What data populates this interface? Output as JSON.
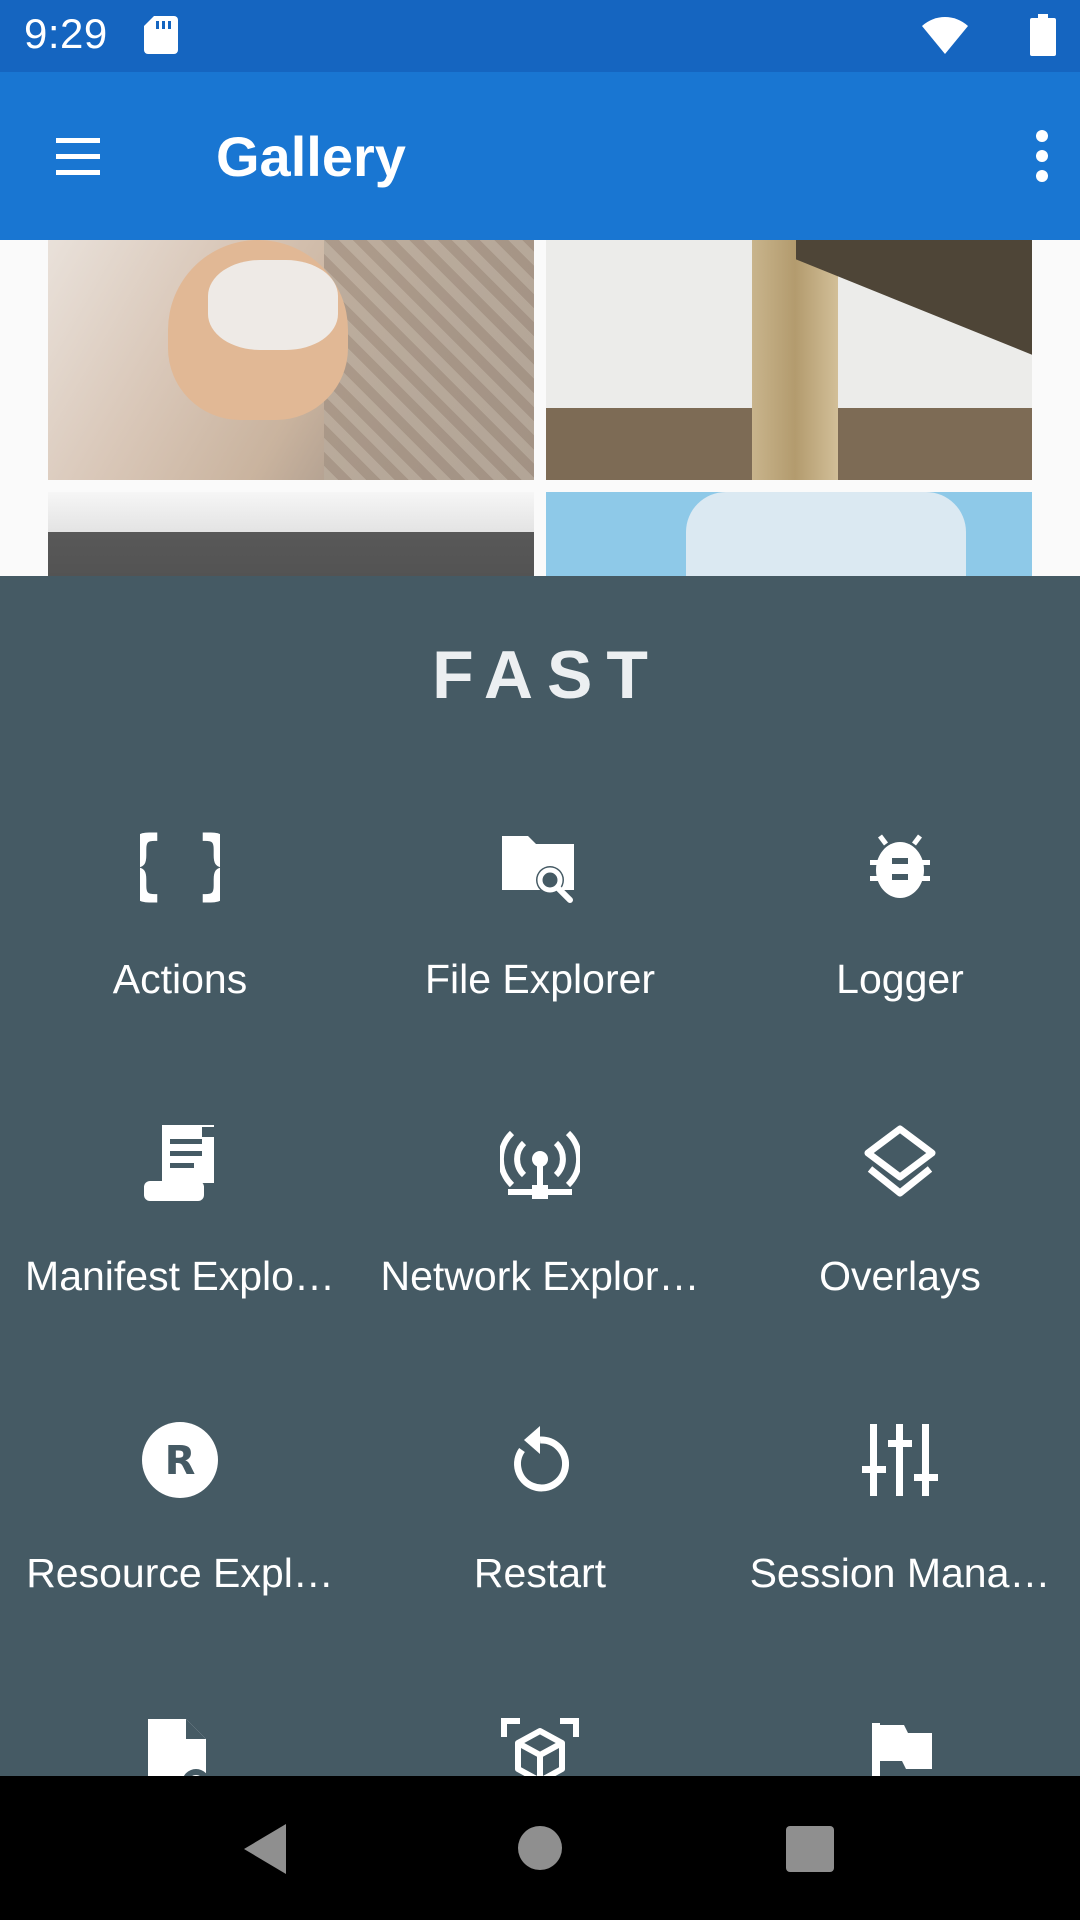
{
  "status_bar": {
    "time": "9:29"
  },
  "app_bar": {
    "title": "Gallery"
  },
  "fast_panel": {
    "title": "FAST",
    "items": [
      {
        "label": "Actions",
        "icon": "braces-icon"
      },
      {
        "label": "File Explorer",
        "icon": "folder-search-icon"
      },
      {
        "label": "Logger",
        "icon": "bug-icon"
      },
      {
        "label": "Manifest Explo…",
        "icon": "scroll-icon"
      },
      {
        "label": "Network Explor…",
        "icon": "network-antenna-icon"
      },
      {
        "label": "Overlays",
        "icon": "layers-icon"
      },
      {
        "label": "Resource Expl…",
        "icon": "resource-r-icon"
      },
      {
        "label": "Restart",
        "icon": "restart-icon"
      },
      {
        "label": "Session Mana…",
        "icon": "sliders-icon"
      },
      {
        "label": "",
        "icon": "file-settings-icon"
      },
      {
        "label": "",
        "icon": "cube-scan-icon"
      },
      {
        "label": "",
        "icon": "flag-icon"
      }
    ]
  },
  "colors": {
    "status_bar": "#1565C0",
    "app_bar": "#1976D2",
    "panel": "#455A64",
    "nav_bar": "#000000"
  }
}
